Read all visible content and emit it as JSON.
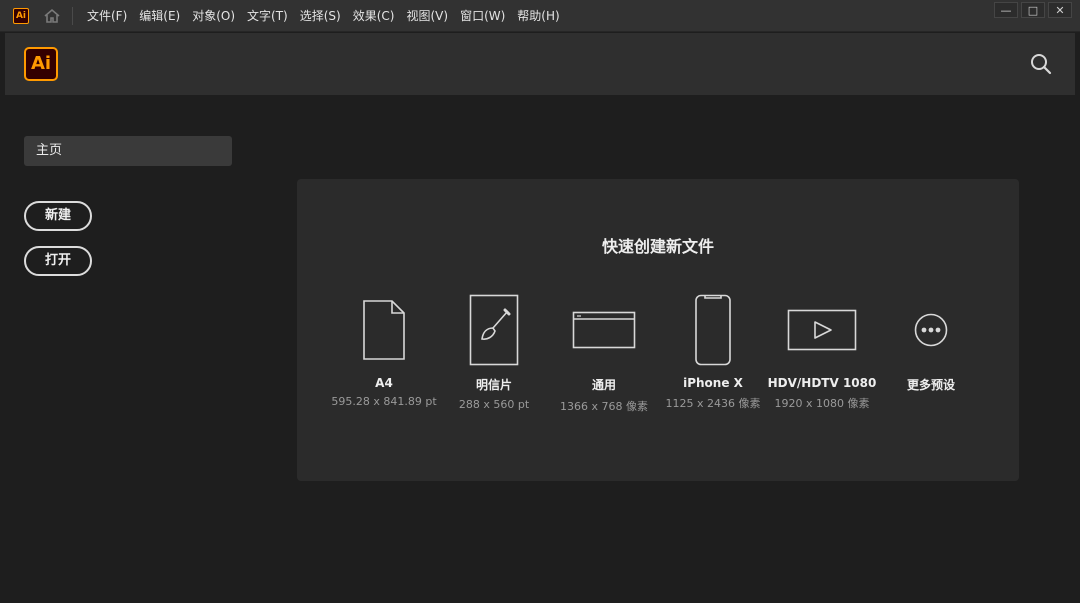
{
  "app": {
    "icon_text": "Ai",
    "logo_text": "Ai",
    "accent": "#ff9a00",
    "logo_bg": "#330000"
  },
  "menu": [
    {
      "label": "文件(F)"
    },
    {
      "label": "编辑(E)"
    },
    {
      "label": "对象(O)"
    },
    {
      "label": "文字(T)"
    },
    {
      "label": "选择(S)"
    },
    {
      "label": "效果(C)"
    },
    {
      "label": "视图(V)"
    },
    {
      "label": "窗口(W)"
    },
    {
      "label": "帮助(H)"
    }
  ],
  "window_controls": {
    "minimize": "—",
    "maximize": "□",
    "close": "✕"
  },
  "sidebar": {
    "home_tab": "主页",
    "new_button": "新建",
    "open_button": "打开"
  },
  "quick_create": {
    "title": "快速创建新文件",
    "presets": [
      {
        "name": "A4",
        "size": "595.28 x 841.89 pt",
        "icon": "document-icon"
      },
      {
        "name": "明信片",
        "size": "288 x 560 pt",
        "icon": "brush-artboard-icon"
      },
      {
        "name": "通用",
        "size": "1366 x 768 像素",
        "icon": "browser-window-icon"
      },
      {
        "name": "iPhone X",
        "size": "1125 x 2436 像素",
        "icon": "phone-icon"
      },
      {
        "name": "HDV/HDTV 1080",
        "size": "1920 x 1080 像素",
        "icon": "video-icon"
      },
      {
        "name": "更多预设",
        "size": "",
        "icon": "more-icon"
      }
    ]
  }
}
